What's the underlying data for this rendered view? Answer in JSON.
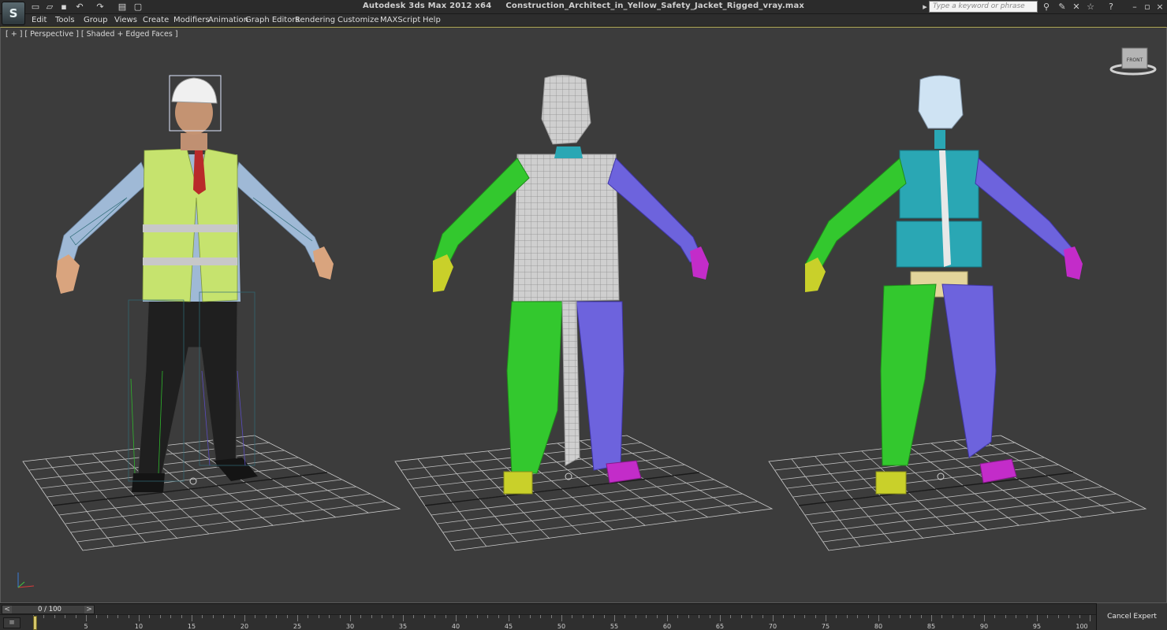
{
  "titlebar": {
    "app_name": "Autodesk 3ds Max  2012 x64",
    "file_name": "Construction_Architect_in_Yellow_Safety_Jacket_Rigged_vray.max",
    "logo_letter": "S",
    "search_placeholder": "Type a keyword or phrase"
  },
  "menu": [
    "Edit",
    "Tools",
    "Group",
    "Views",
    "Create",
    "Modifiers",
    "Animation",
    "Graph Editors",
    "Rendering",
    "Customize",
    "MAXScript",
    "Help"
  ],
  "viewport": {
    "label": "[ + ] [ Perspective ] [ Shaded + Edged Faces ]",
    "viewcube_label": "FRONT",
    "background": "#3c3c3c",
    "colors": {
      "biped_left": "#33c82e",
      "biped_right": "#6d63dd",
      "spine": "#2aa7b4",
      "pelvis": "#e3d59b",
      "foot_left": "#c9d02a",
      "foot_right": "#c32cc9",
      "vest": "#c5e36a",
      "shirt": "#9bb6d4",
      "trousers": "#1e1e1e",
      "helmet": "#eeeeee"
    }
  },
  "timeline": {
    "slider_label": "0 / 100",
    "prev": "<",
    "next": ">",
    "ticks": [
      "5",
      "10",
      "15",
      "20",
      "25",
      "30",
      "35",
      "40",
      "45",
      "50",
      "55",
      "60",
      "65",
      "70",
      "75",
      "80",
      "85",
      "90",
      "95",
      "100"
    ]
  },
  "status": {
    "cancel_expert_mode": "Cancel Expert Mode"
  }
}
